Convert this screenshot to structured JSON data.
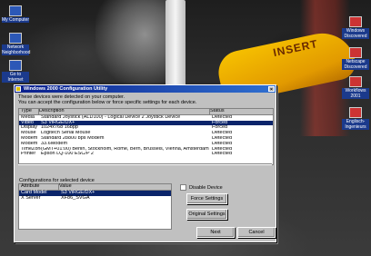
{
  "desktop": {
    "photo_text": "INSERT",
    "icons_left": [
      {
        "label": "My Computer",
        "icon": "computer-icon"
      },
      {
        "label": "Network Neighborhood",
        "icon": "network-icon"
      },
      {
        "label": "Go to Internet",
        "icon": "internet-icon"
      }
    ],
    "icons_right": [
      {
        "label": "Windows Discovered",
        "icon": "windows-icon"
      },
      {
        "label": "Netscape Discovered",
        "icon": "netscape-icon"
      },
      {
        "label": "Workflows 2001",
        "icon": "workflow-icon"
      },
      {
        "label": "Englisch-Ingenieurs",
        "icon": "document-icon"
      }
    ]
  },
  "dialog": {
    "title": "Windows 2000 Configuration Utility",
    "close": "×",
    "intro_line1": "These devices were detected on your computer.",
    "intro_line2": "You can accept the configuration below or force specific settings for each device.",
    "columns": [
      "Type",
      "Description",
      "Status"
    ],
    "devices": [
      {
        "type": "Media",
        "description": "Standard Joystick (ALD100) - Logical Device 2 Joystick Device",
        "status": "Detected"
      },
      {
        "type": "Video",
        "description": "S3 ViRGE/DX+",
        "status": "Forced",
        "selected": true
      },
      {
        "type": "Display",
        "description": "1024x768 16bpp",
        "status": "Forced"
      },
      {
        "type": "Mouse",
        "description": "Logitech Serial Mouse",
        "status": "Detected"
      },
      {
        "type": "Modem",
        "description": "Standard 28800 bps Modem",
        "status": "Detected"
      },
      {
        "type": "Modem",
        "description": "33.6Modem",
        "status": "Detected"
      },
      {
        "type": "TimeZone",
        "description": "(GMT+01:00) Berlin, Stockholm, Rome, Bern, Brussels, Vienna, Amsterdam",
        "status": "Detected"
      },
      {
        "type": "Printer",
        "description": "Epson LQ-100 ESC/P 2",
        "status": "Detected"
      }
    ],
    "config_label": "Configurations for selected device",
    "settings_columns": [
      "Attribute",
      "Value"
    ],
    "settings": [
      {
        "attribute": "Card Model",
        "value": "S3 ViRGE/DX+",
        "selected": true
      },
      {
        "attribute": "X Server",
        "value": "XF86_SVGA"
      }
    ],
    "disable_label": "Disable Device",
    "force_label": "Force Settings",
    "original_label": "Original Settings",
    "next_label": "Next",
    "cancel_label": "Cancel"
  }
}
